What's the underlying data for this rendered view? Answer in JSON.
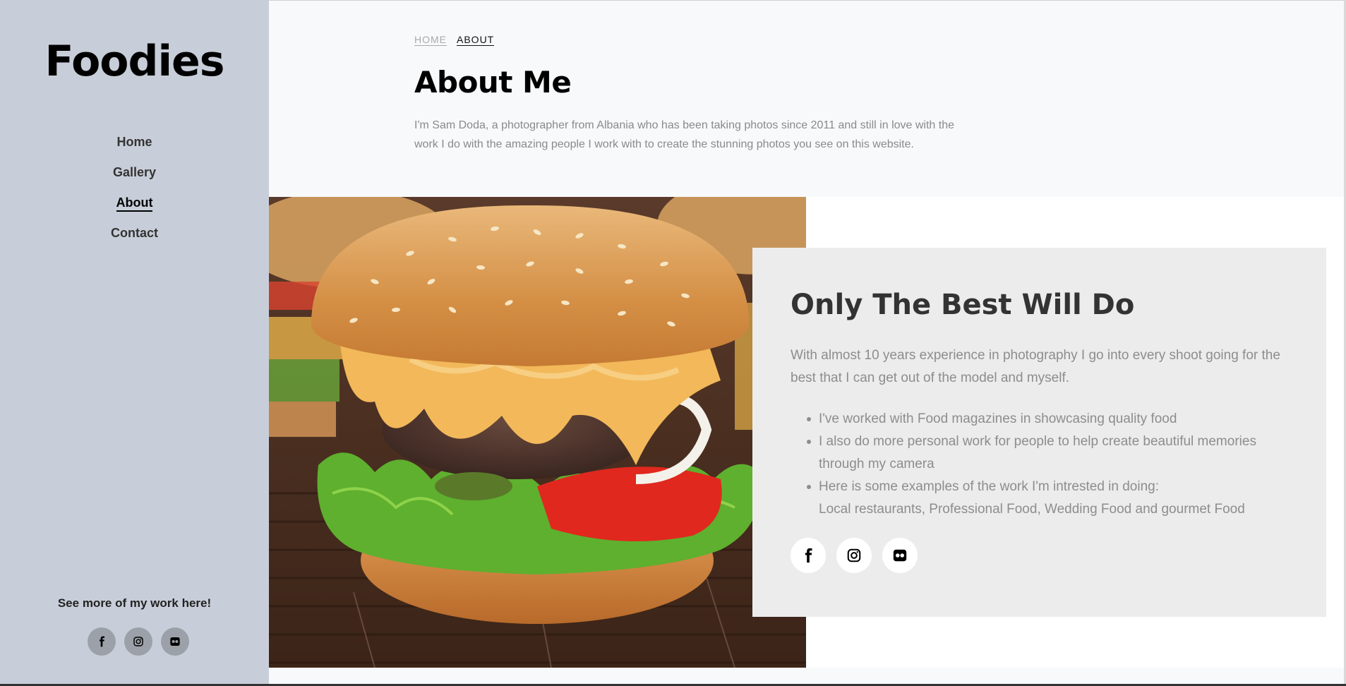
{
  "sidebar": {
    "logo": "Foodies",
    "nav": [
      {
        "label": "Home",
        "active": false
      },
      {
        "label": "Gallery",
        "active": false
      },
      {
        "label": "About",
        "active": true
      },
      {
        "label": "Contact",
        "active": false
      }
    ],
    "cta": "See more of my work here!",
    "social_icons": [
      "facebook-icon",
      "instagram-icon",
      "flickr-icon"
    ]
  },
  "breadcrumb": {
    "home": "HOME",
    "current": "ABOUT"
  },
  "page": {
    "title": "About Me",
    "intro_line1": "I'm Sam Doda, a photographer from Albania who has been taking photos since 2011 and still in love with the",
    "intro_line2": "work I do with the amazing people I work with to create the stunning photos you see on this website."
  },
  "card": {
    "title": "Only The Best Will Do",
    "text": "With almost 10 years experience in photography I go into every shoot going for the best that I can get out of the model and myself.",
    "bullets": [
      "I've worked with Food magazines in showcasing quality food",
      "I also do more personal work for people to help create beautiful memories through my camera",
      "Here is some examples of the work I'm intrested in doing:",
      "Local restaurants, Professional Food, Wedding Food and gourmet Food"
    ],
    "social_icons": [
      "facebook-icon",
      "instagram-icon",
      "flickr-icon"
    ]
  },
  "colors": {
    "sidebar_bg": "#c8ced9",
    "main_bg": "#f8f9fb",
    "card_bg": "#ececec",
    "text_muted": "#8d8d8d"
  }
}
